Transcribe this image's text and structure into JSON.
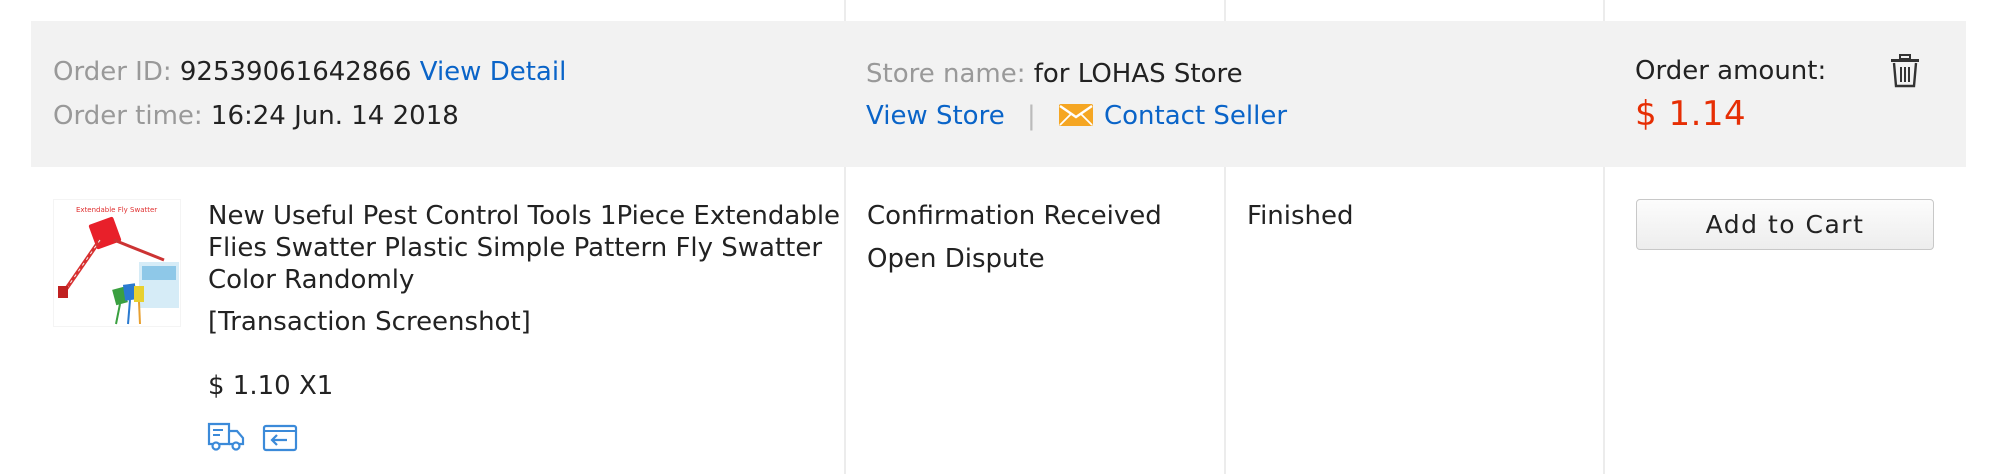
{
  "order": {
    "id_label": "Order ID:",
    "id_value": "92539061642866",
    "view_detail": "View Detail",
    "time_label": "Order time:",
    "time_value": "16:24 Jun. 14 2018",
    "store_label": "Store name:",
    "store_value": "for LOHAS Store",
    "view_store": "View Store",
    "separator": "|",
    "contact_seller": "Contact Seller",
    "amount_label": "Order amount:",
    "amount_value": "$ 1.14"
  },
  "product": {
    "title": "New Useful Pest Control Tools 1Piece Extendable Flies Swatter Plastic Simple Pattern Fly Swatter Color Randomly",
    "snapshot": "[Transaction Screenshot]",
    "price_qty": "$ 1.10 X1",
    "thumb_caption": "Extendable Fly Swatter"
  },
  "status": {
    "confirmation": "Confirmation Received",
    "dispute": "Open Dispute",
    "order_status": "Finished"
  },
  "actions": {
    "add_to_cart": "Add to Cart"
  },
  "icons": {
    "delete": "trash-icon",
    "contact": "envelope-icon",
    "shipping": "truck-icon",
    "return": "return-box-icon"
  },
  "colors": {
    "link": "#0a64c8",
    "price": "#e62e04",
    "header_bg": "#f2f2f2",
    "envelope": "#f5a623"
  }
}
